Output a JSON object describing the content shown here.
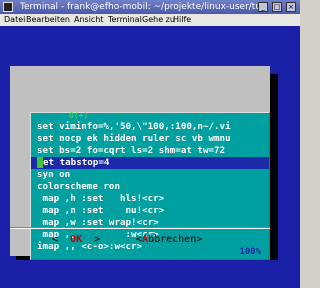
{
  "window": {
    "title": "Terminal - frank@efho-mobil: ~/projekte/linux-user/tul"
  },
  "menu": [
    "Datei",
    "Bearbeiten",
    "Ansicht",
    "Terminal",
    "Gehe zu",
    "Hilfe"
  ],
  "dialog": {
    "top_marker": "0(+)",
    "lines": [
      "set viminfo=%,'50,\\\"100,:100,n~/.vi",
      "set nocp ek hidden ruler sc vb wmnu",
      "set bs=2 fo=cqrt ls=2 shm=at tw=72",
      "et tabstop=4",
      "syn on",
      "colorscheme ron",
      " map ,h :set   hls!<cr>",
      " map ,n :set    nu!<cr>",
      " map ,w :set wrap!<cr>",
      " map ,,         :w<cr>",
      "imap ,, <c-o>:w<cr>"
    ],
    "selected_index": 3,
    "scroll_percent": "100%",
    "ok_button": {
      "open": "<  ",
      "label": "OK",
      "close": "  >"
    },
    "cancel_button": {
      "open": "<",
      "accel": "A",
      "rest": "bbrechen",
      "close": ">"
    }
  }
}
